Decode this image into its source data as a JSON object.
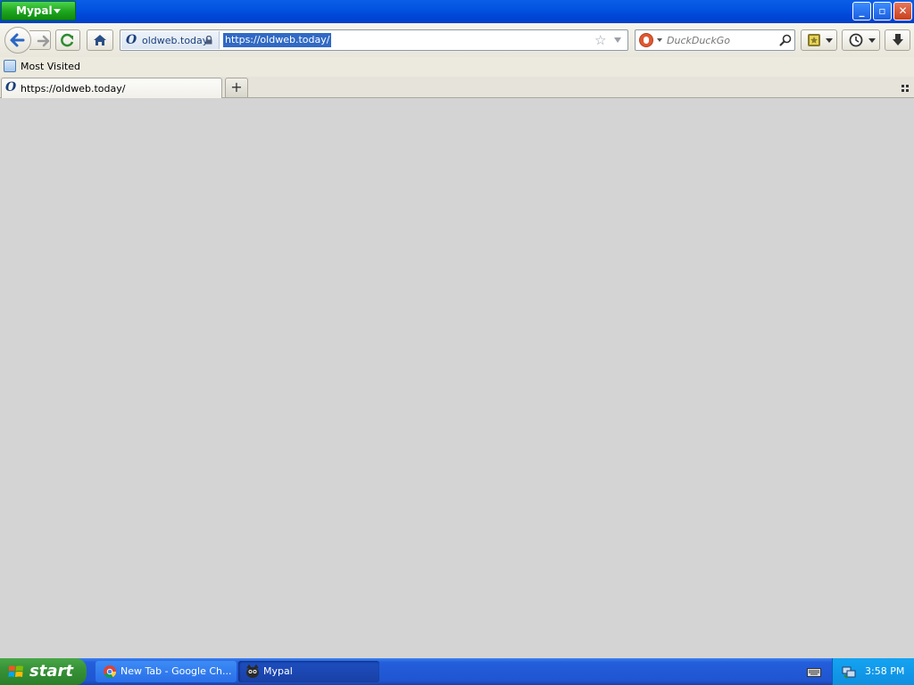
{
  "window": {
    "app_menu_label": "Mypal",
    "minimize_label": "_",
    "maximize_label": "▫",
    "close_label": "✕"
  },
  "navbar": {
    "identity_label": "oldweb.today",
    "url": "https://oldweb.today/",
    "search_placeholder": "DuckDuckGo",
    "search_engine": "DuckDuckGo"
  },
  "bookmarks_bar": {
    "items": [
      {
        "label": "Most Visited",
        "icon": "most-visited-icon"
      }
    ]
  },
  "tabs": {
    "items": [
      {
        "title": "https://oldweb.today/",
        "active": true
      }
    ],
    "new_tab_label": "+"
  },
  "taskbar": {
    "start_label": "start",
    "tasks": [
      {
        "label": "New Tab - Google Ch...",
        "icon": "chrome-icon",
        "active": false
      },
      {
        "label": "Mypal",
        "icon": "mypal-icon",
        "active": true
      }
    ],
    "clock": "3:58 PM"
  },
  "colors": {
    "titlebar": "#0353e0",
    "app_menu": "#1ea51e",
    "content_bg": "#d4d4d4",
    "taskbar": "#245edb",
    "start_button": "#379237",
    "selection": "#316ac5"
  }
}
